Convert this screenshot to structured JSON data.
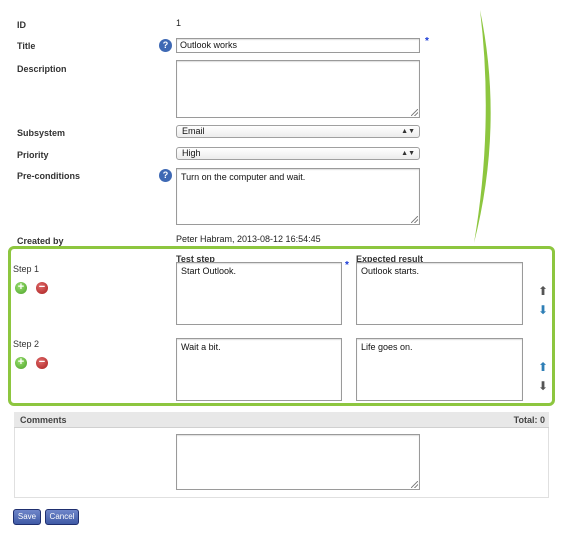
{
  "fields": {
    "id_label": "ID",
    "id_value": "1",
    "title_label": "Title",
    "title_value": "Outlook works",
    "required_marker": "*",
    "description_label": "Description",
    "description_value": "",
    "subsystem_label": "Subsystem",
    "subsystem_value": "Email",
    "priority_label": "Priority",
    "priority_value": "High",
    "preconditions_label": "Pre-conditions",
    "preconditions_value": "Turn on the computer and wait.",
    "created_by_label": "Created by",
    "created_by_value": "Peter Habram, 2013-08-12 16:54:45",
    "help_glyph": "?"
  },
  "steps": {
    "test_step_header": "Test step",
    "expected_result_header": "Expected result",
    "items": [
      {
        "label": "Step 1",
        "test_step": "Start Outlook.",
        "expected": "Outlook starts."
      },
      {
        "label": "Step 2",
        "test_step": "Wait a bit.",
        "expected": "Life goes on."
      }
    ],
    "add_glyph": "+",
    "remove_glyph": "−",
    "up_glyph": "⬆",
    "down_glyph": "⬇"
  },
  "comments": {
    "title": "Comments",
    "total": "Total: 0",
    "value": ""
  },
  "buttons": {
    "save": "Save",
    "cancel": "Cancel"
  },
  "colors": {
    "steps_border": "#8dc63f",
    "button_blue": "#3f5aa6",
    "help_blue": "#3e69b4"
  }
}
